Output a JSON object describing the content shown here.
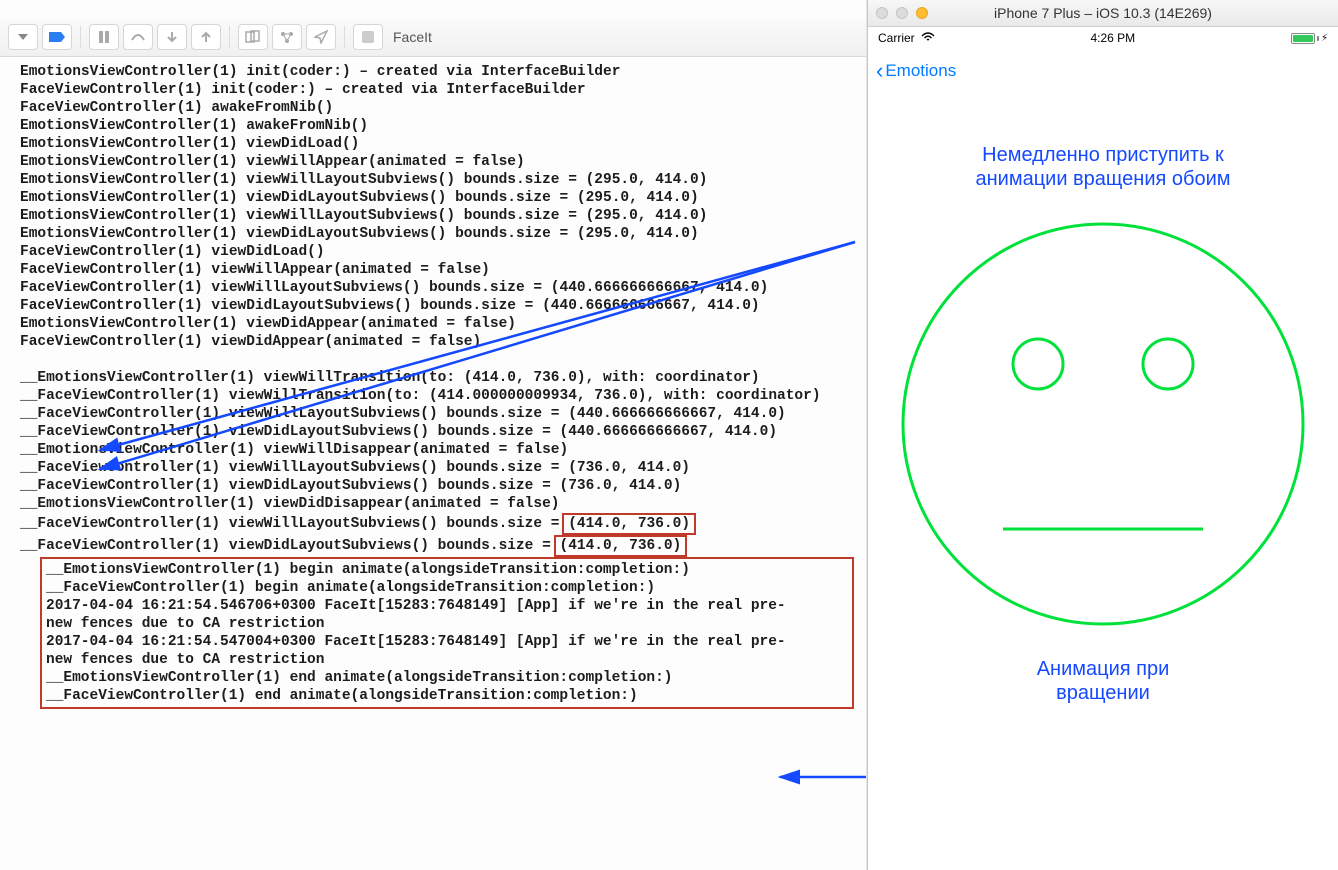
{
  "toolbar": {
    "scheme": "FaceIt"
  },
  "console": {
    "lines": [
      "EmotionsViewController(1) init(coder:) – created via InterfaceBuilder",
      "FaceViewController(1) init(coder:) – created via InterfaceBuilder",
      "FaceViewController(1) awakeFromNib()",
      "EmotionsViewController(1) awakeFromNib()",
      "EmotionsViewController(1) viewDidLoad()",
      "EmotionsViewController(1) viewWillAppear(animated = false)",
      "EmotionsViewController(1) viewWillLayoutSubviews() bounds.size = (295.0, 414.0)",
      "EmotionsViewController(1) viewDidLayoutSubviews() bounds.size = (295.0, 414.0)",
      "EmotionsViewController(1) viewWillLayoutSubviews() bounds.size = (295.0, 414.0)",
      "EmotionsViewController(1) viewDidLayoutSubviews() bounds.size = (295.0, 414.0)",
      "FaceViewController(1) viewDidLoad()",
      "FaceViewController(1) viewWillAppear(animated = false)",
      "FaceViewController(1) viewWillLayoutSubviews() bounds.size = (440.666666666667, 414.0)",
      "FaceViewController(1) viewDidLayoutSubviews() bounds.size = (440.666666666667, 414.0)",
      "EmotionsViewController(1) viewDidAppear(animated = false)",
      "FaceViewController(1) viewDidAppear(animated = false)"
    ],
    "lines2": [
      "__EmotionsViewController(1) viewWillTransition(to: (414.0, 736.0), with: coordinator)",
      "__FaceViewController(1) viewWillTransition(to: (414.000000009934, 736.0), with: coordinator)",
      "__FaceViewController(1) viewWillLayoutSubviews() bounds.size = (440.666666666667, 414.0)",
      "__FaceViewController(1) viewDidLayoutSubviews() bounds.size = (440.666666666667, 414.0)",
      "__EmotionsViewController(1) viewWillDisappear(animated = false)",
      "__FaceViewController(1) viewWillLayoutSubviews() bounds.size = (736.0, 414.0)",
      "__FaceViewController(1) viewDidLayoutSubviews() bounds.size = (736.0, 414.0)",
      "__EmotionsViewController(1) viewDidDisappear(animated = false)"
    ],
    "line_box_a": "__FaceViewController(1) viewWillLayoutSubviews() bounds.size = ",
    "line_box_a_boxed": "(414.0, 736.0)",
    "line_box_b": "__FaceViewController(1) viewDidLayoutSubviews() bounds.size = ",
    "line_box_b_boxed": "(414.0, 736.0)",
    "block": [
      "EmotionsViewController(1) begin animate(alongsideTransition:completion:)",
      "FaceViewController(1) begin animate(alongsideTransition:completion:)",
      "2017-04-04 16:21:54.546706+0300 FaceIt[15283:7648149] [App] if we're in the real pre-",
      "new fences due to CA restriction",
      "2017-04-04 16:21:54.547004+0300 FaceIt[15283:7648149] [App] if we're in the real pre-",
      "new fences due to CA restriction",
      "EmotionsViewController(1) end animate(alongsideTransition:completion:)",
      "FaceViewController(1) end animate(alongsideTransition:completion:)"
    ],
    "block_prefix": "__"
  },
  "simulator": {
    "title": "iPhone 7 Plus – iOS 10.3 (14E269)",
    "status": {
      "carrier": "Carrier",
      "time": "4:26 PM"
    },
    "nav_back": "Emotions",
    "annotation_top_l1": "Немедленно приступить к",
    "annotation_top_l2": "анимации вращения обоим",
    "annotation_bottom_l1": "Анимация при",
    "annotation_bottom_l2": "вращении"
  },
  "colors": {
    "accent_blue": "#1549ff",
    "ios_blue": "#007aff",
    "face_green": "#00e23a",
    "red_box": "#c0392b"
  }
}
